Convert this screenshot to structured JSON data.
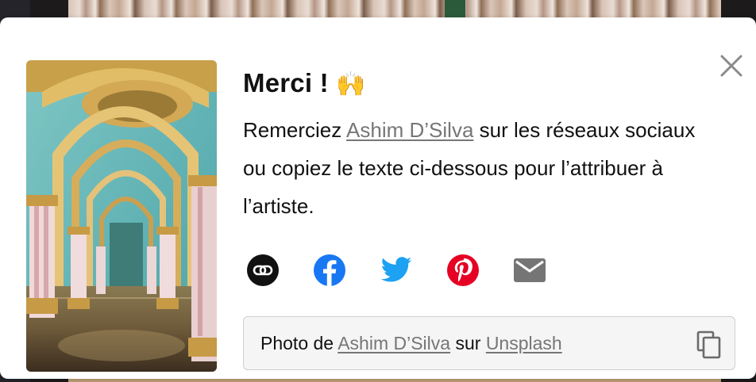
{
  "dialog": {
    "title": "Merci !",
    "emoji": "🙌",
    "description": {
      "before": "Remerciez ",
      "author": "Ashim D’Silva",
      "after": " sur les réseaux sociaux ou copiez le texte ci-dessous pour l’attribuer à l’artiste."
    },
    "share_icons": [
      "link-icon",
      "facebook-icon",
      "twitter-icon",
      "pinterest-icon",
      "mail-icon"
    ],
    "credit": {
      "prefix": "Photo de ",
      "author": "Ashim D’Silva",
      "middle": " sur ",
      "site": "Unsplash"
    },
    "close_icon": "close-icon",
    "copy_icon": "copy-icon"
  },
  "colors": {
    "link_gray": "#767676",
    "facebook": "#1877F2",
    "twitter": "#1DA1F2",
    "pinterest": "#E60023",
    "mail": "#757575"
  }
}
